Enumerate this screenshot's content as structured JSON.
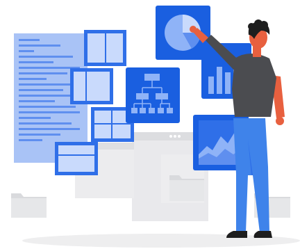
{
  "illustration": {
    "subject": "person-interacting-with-floating-data-panels",
    "icons": [
      "document-icon",
      "layout-panel-icon",
      "pie-chart-icon",
      "org-chart-icon",
      "bar-chart-icon",
      "area-chart-icon",
      "folder-icon",
      "browser-window-icon"
    ]
  },
  "colors": {
    "primary_blue": "#1a5fe0",
    "panel_blue": "#2f6fe8",
    "light_blue": "#8fb3f7",
    "pale_blue": "#c9dafc",
    "document_blue": "#a9c3f6",
    "grey_bg": "#e9e9ec",
    "grey_dark": "#cfd0d4",
    "shirt": "#4b4c50",
    "pants": "#3f83ea",
    "skin": "#e8603f",
    "hair": "#1e1e1e",
    "shadow": "#eeeeef"
  }
}
